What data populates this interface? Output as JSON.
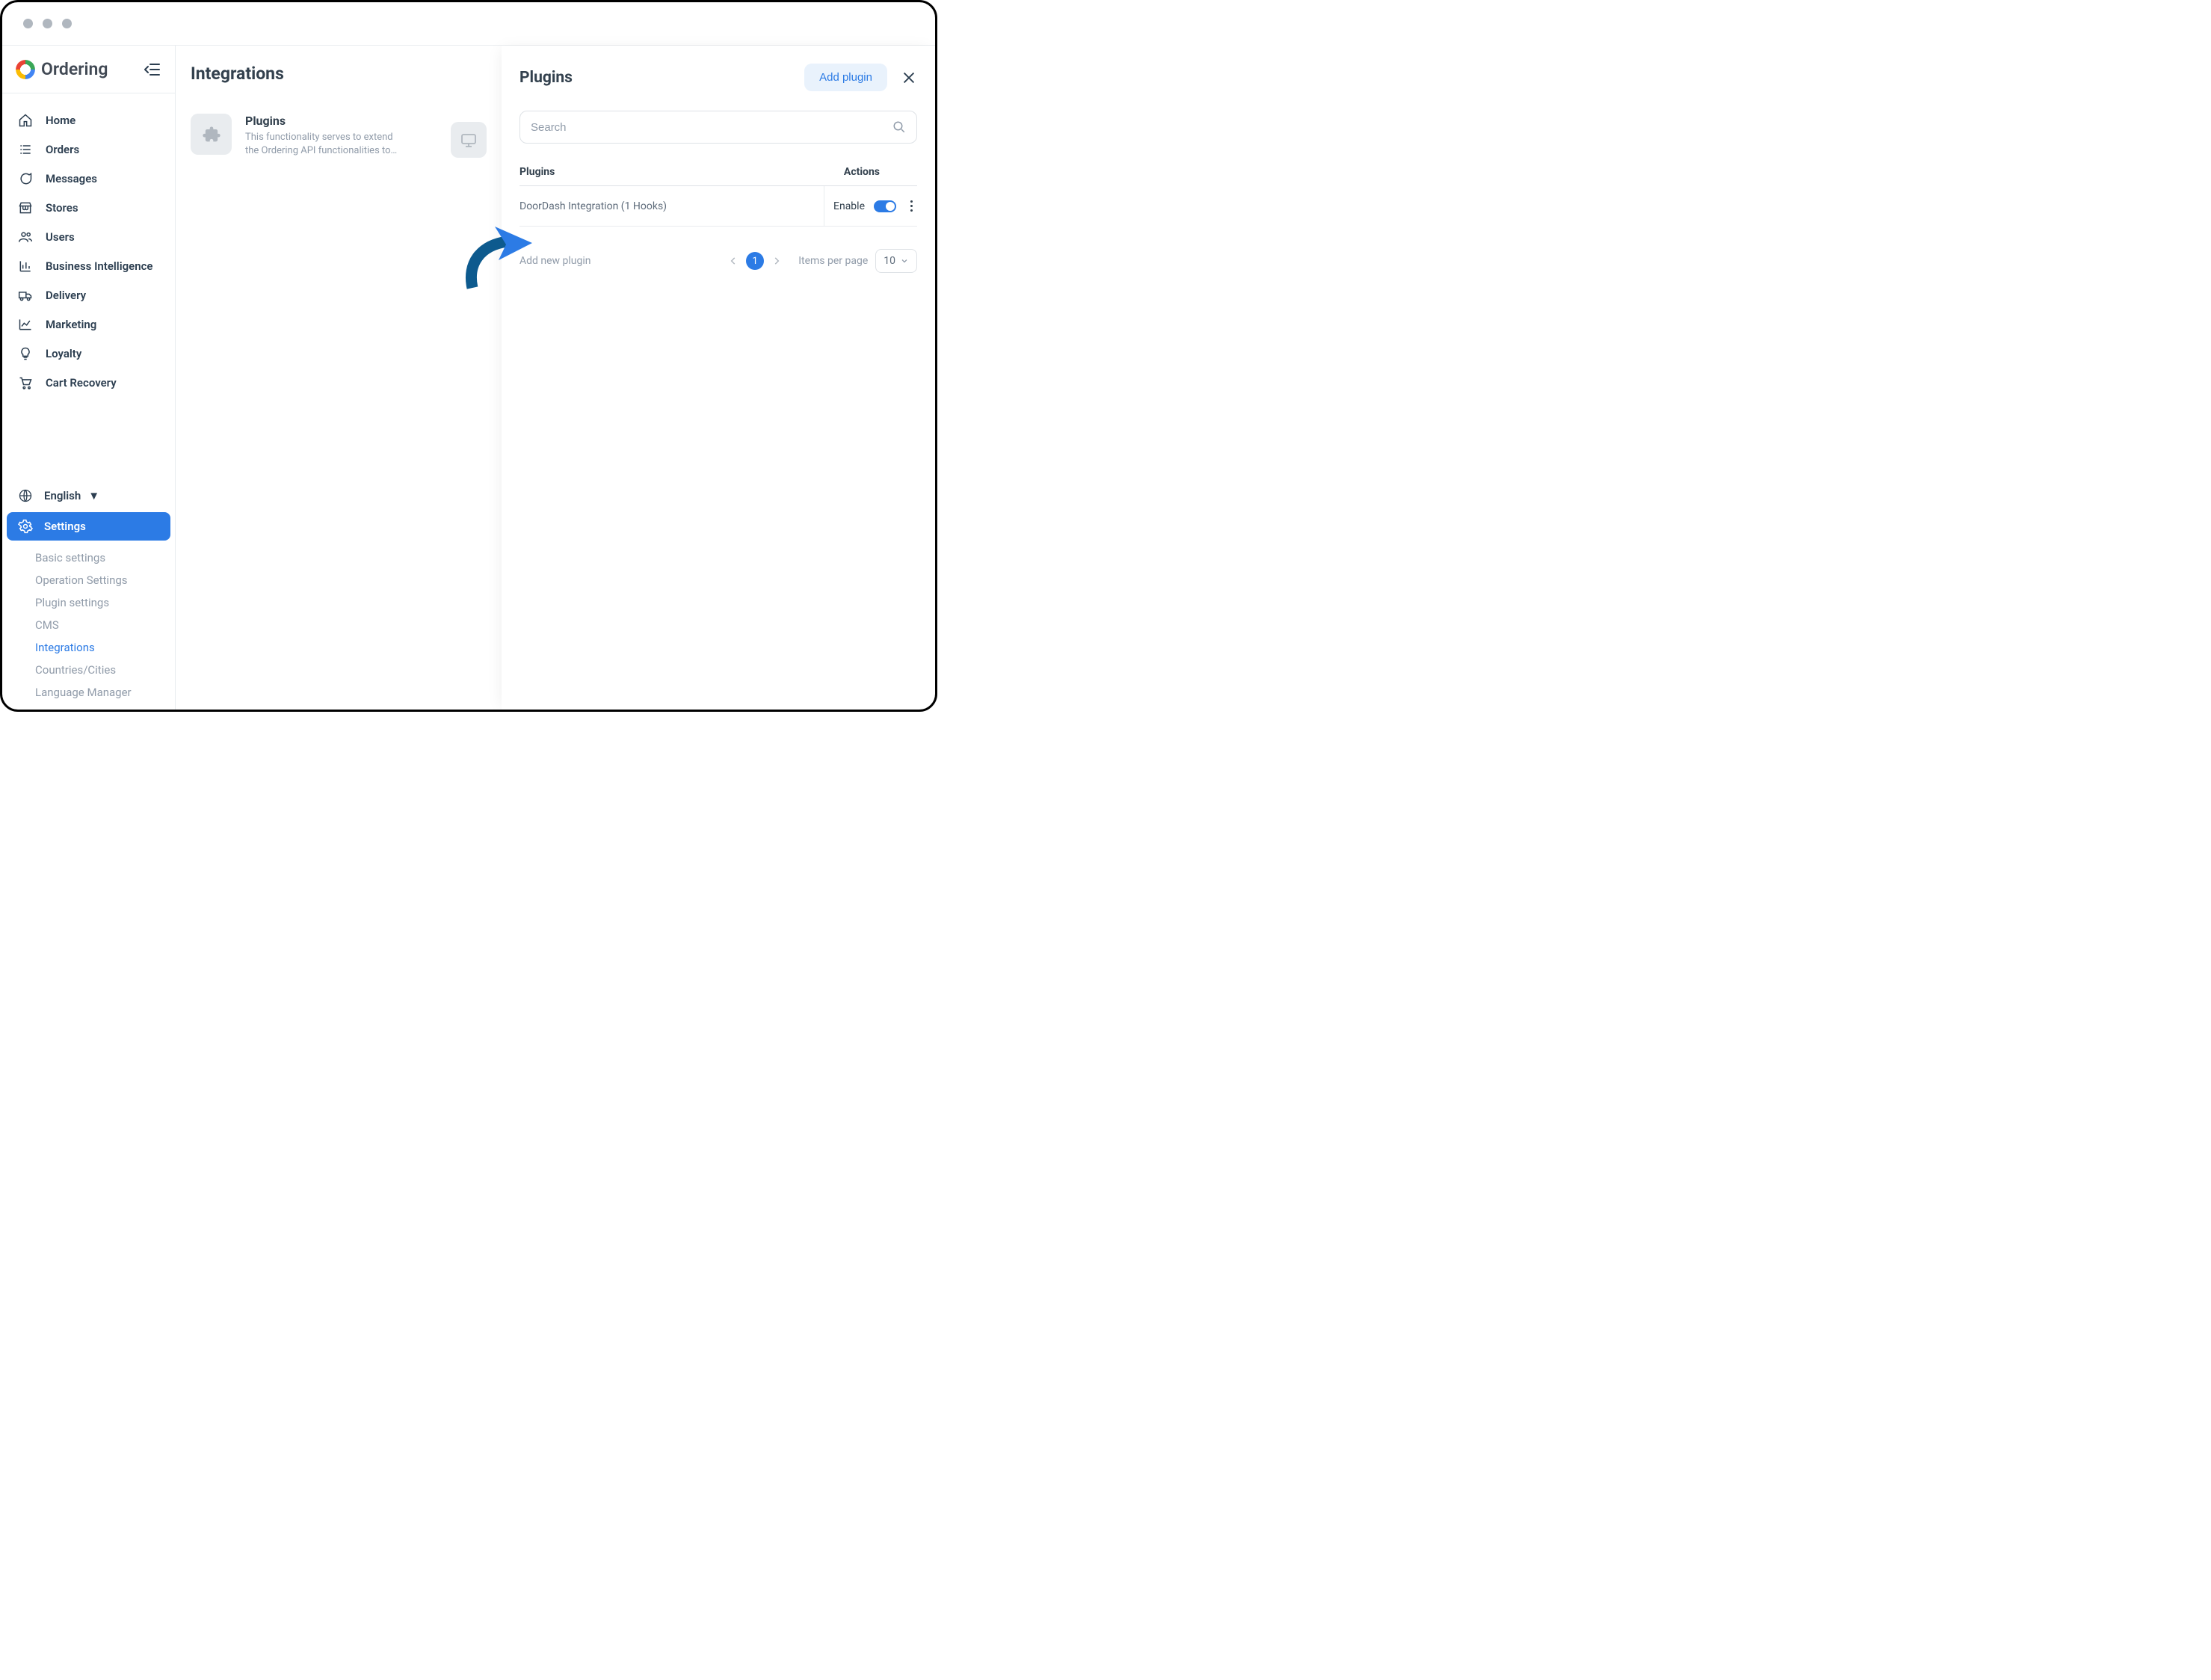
{
  "brand": {
    "name": "Ordering"
  },
  "sidebar": {
    "items": [
      {
        "label": "Home"
      },
      {
        "label": "Orders"
      },
      {
        "label": "Messages"
      },
      {
        "label": "Stores"
      },
      {
        "label": "Users"
      },
      {
        "label": "Business Intelligence"
      },
      {
        "label": "Delivery"
      },
      {
        "label": "Marketing"
      },
      {
        "label": "Loyalty"
      },
      {
        "label": "Cart Recovery"
      }
    ],
    "language": "English",
    "settings_label": "Settings",
    "sub": [
      {
        "label": "Basic settings"
      },
      {
        "label": "Operation Settings"
      },
      {
        "label": "Plugin settings"
      },
      {
        "label": "CMS"
      },
      {
        "label": "Integrations",
        "active": true
      },
      {
        "label": "Countries/Cities"
      },
      {
        "label": "Language Manager"
      }
    ]
  },
  "mid": {
    "title": "Integrations",
    "card": {
      "title": "Plugins",
      "desc": "This functionality serves to extend the Ordering API functionalities to…"
    }
  },
  "panel": {
    "title": "Plugins",
    "add_button": "Add plugin",
    "search_placeholder": "Search",
    "columns": {
      "name": "Plugins",
      "actions": "Actions"
    },
    "rows": [
      {
        "name": "DoorDash Integration (1 Hooks)",
        "enable_label": "Enable"
      }
    ],
    "add_link": "Add new plugin",
    "page_current": "1",
    "ipp_label": "Items per page",
    "ipp_value": "10"
  }
}
